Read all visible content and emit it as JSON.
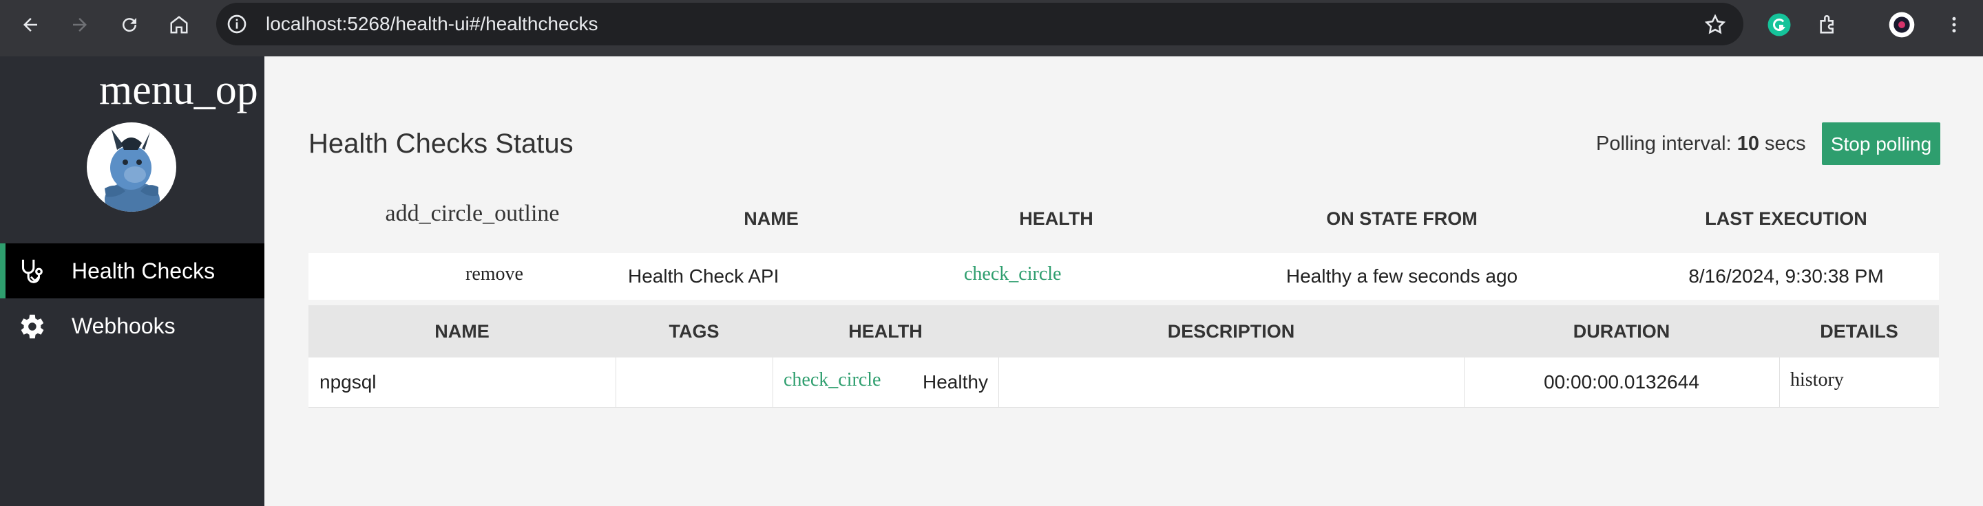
{
  "browser": {
    "url": "localhost:5268/health-ui#/healthchecks"
  },
  "sidebar": {
    "menu_title": "menu_op",
    "items": [
      {
        "label": "Health Checks",
        "icon": "stethoscope-icon",
        "active": true
      },
      {
        "label": "Webhooks",
        "icon": "gear-icon",
        "active": false
      }
    ]
  },
  "main": {
    "title": "Health Checks Status",
    "polling_prefix": "Polling interval: ",
    "polling_value": "10",
    "polling_suffix": " secs",
    "stop_button": "Stop polling",
    "columns": {
      "expand": "add_circle_outline",
      "name": "NAME",
      "health": "HEALTH",
      "on_state_from": "ON STATE FROM",
      "last_execution": "LAST EXECUTION"
    },
    "row": {
      "toggle": "remove",
      "name": "Health Check API",
      "health_icon": "check_circle",
      "on_state_from": "Healthy a few seconds ago",
      "last_execution": "8/16/2024, 9:30:38 PM"
    },
    "sub_columns": {
      "name": "NAME",
      "tags": "TAGS",
      "health": "HEALTH",
      "description": "DESCRIPTION",
      "duration": "DURATION",
      "details": "DETAILS"
    },
    "sub_row": {
      "name": "npgsql",
      "tags": "",
      "health_icon": "check_circle",
      "health": "Healthy",
      "description": "",
      "duration": "00:00:00.0132644",
      "details": "history"
    }
  },
  "colors": {
    "accent": "#2e9e6e",
    "sidebar": "#2b2d33",
    "chrome": "#35363a"
  }
}
